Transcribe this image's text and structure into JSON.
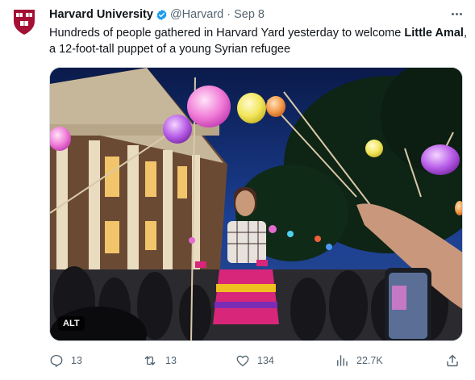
{
  "account": {
    "display_name": "Harvard University",
    "handle": "@Harvard",
    "separator": "·",
    "date": "Sep 8",
    "avatar_icon": "harvard-shield-logo",
    "verified_icon": "verified-badge-icon"
  },
  "tweet": {
    "text_before": "Hundreds of people gathered in Harvard Yard yesterday to welcome ",
    "text_bold": "Little Amal",
    "text_after": ", a 12-foot-tall puppet of a young Syrian refugee"
  },
  "media": {
    "alt_label": "ALT"
  },
  "actions": {
    "reply_count": "13",
    "retweet_count": "13",
    "like_count": "134",
    "views_count": "22.7K"
  },
  "colors": {
    "text_primary": "#0f1419",
    "text_secondary": "#536471",
    "verified_blue": "#1d9bf0",
    "harvard_crimson": "#a41034"
  }
}
